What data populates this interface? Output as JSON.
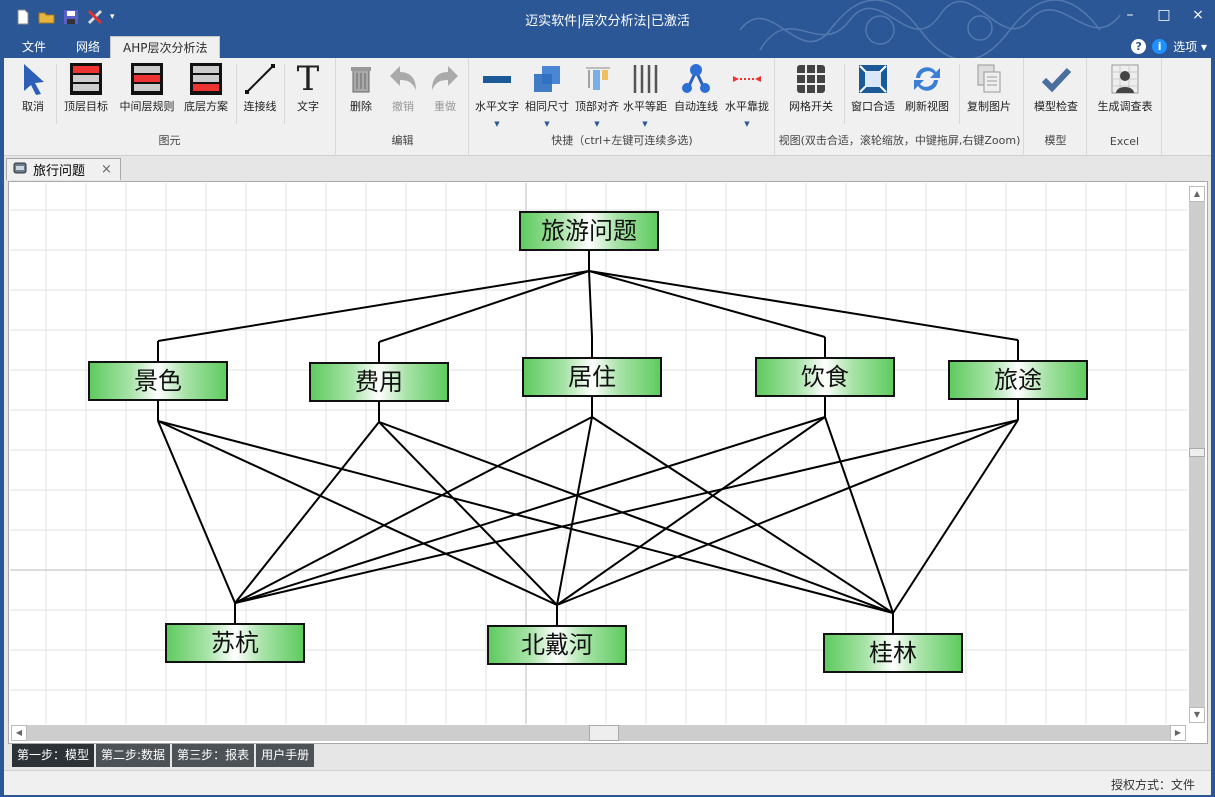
{
  "window": {
    "title": "迈实软件|层次分析法|已激活",
    "controls": {
      "minimize": "–",
      "maximize": "□",
      "close": "×"
    }
  },
  "quick_access": [
    {
      "name": "new-file-icon"
    },
    {
      "name": "open-folder-icon"
    },
    {
      "name": "save-icon"
    },
    {
      "name": "tools-icon"
    },
    {
      "name": "customize-dropdown-icon"
    }
  ],
  "ribbon_tabs": [
    {
      "label": "文件",
      "active": false
    },
    {
      "label": "网络",
      "active": false
    },
    {
      "label": "AHP层次分析法",
      "active": true
    }
  ],
  "help": {
    "help_icon": "?",
    "info_icon": "i",
    "options_label": "选项 ▾"
  },
  "ribbon": {
    "groups": [
      {
        "label": "图元",
        "buttons": [
          "取消",
          "顶层目标",
          "中间层规则",
          "底层方案",
          "连接线",
          "文字"
        ]
      },
      {
        "label": "编辑",
        "buttons": [
          "删除",
          "撤销",
          "重做"
        ]
      },
      {
        "label": "快捷（ctrl+左键可连续多选)",
        "buttons": [
          "水平文字",
          "相同尺寸",
          "顶部对齐",
          "水平等距",
          "自动连线",
          "水平靠拢"
        ]
      },
      {
        "label": "视图(双击合适，滚轮缩放，中键拖屏,右键Zoom)",
        "buttons": [
          "网格开关",
          "窗口合适",
          "刷新视图",
          "复制图片"
        ]
      },
      {
        "label": "模型",
        "buttons": [
          "模型检查"
        ]
      },
      {
        "label": "Excel",
        "buttons": [
          "生成调查表"
        ]
      }
    ]
  },
  "document_tab": {
    "label": "旅行问题",
    "close": "×"
  },
  "diagram": {
    "goal": "旅游问题",
    "criteria": [
      "景色",
      "费用",
      "居住",
      "饮食",
      "旅途"
    ],
    "alternatives": [
      "苏杭",
      "北戴河",
      "桂林"
    ]
  },
  "steps": [
    {
      "label": "第一步：模型",
      "active": true
    },
    {
      "label": "第二步:数据",
      "active": false
    },
    {
      "label": "第三步：报表",
      "active": false
    },
    {
      "label": "用户手册",
      "active": false
    }
  ],
  "status": {
    "text": "授权方式：文件"
  },
  "colors": {
    "titlebar": "#2b5797",
    "node_green": "#5fcb5f",
    "ribbon_bg": "#f0f0f0"
  }
}
